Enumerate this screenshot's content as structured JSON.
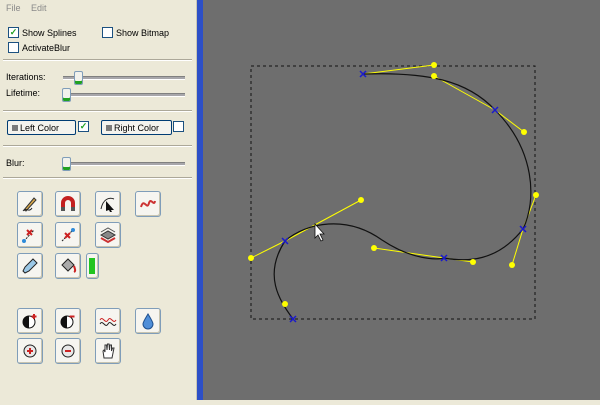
{
  "menu": {
    "file": "File",
    "edit": "Edit"
  },
  "options": {
    "show_splines": "Show Splines",
    "show_bitmap": "Show Bitmap",
    "activate_blur": "ActivateBlur",
    "show_splines_checked": true,
    "show_bitmap_checked": false,
    "activate_blur_checked": false
  },
  "sliders": {
    "iterations_label": "Iterations:",
    "iterations_value": 0.09,
    "lifetime_label": "Lifetime:",
    "lifetime_value": 0.02,
    "blur_label": "Blur:",
    "blur_value": 0.02
  },
  "colors": {
    "left_label": "Left Color",
    "right_label": "Right Color",
    "left_checked": true,
    "right_checked": false,
    "accent": "#21a121",
    "canvas_bg": "#6e6e6e",
    "curve": "#000000",
    "handle": "#ffff00",
    "knot": "#1a1acc"
  },
  "tools": [
    "pencil-icon",
    "magnet-icon",
    "pointer-curve-icon",
    "squiggle-icon",
    "node-left-icon",
    "node-right-icon",
    "layers-icon",
    "eyedropper-icon",
    "paint-bucket-icon",
    "color-bar-icon",
    "contrast-plus-icon",
    "contrast-minus-icon",
    "wave-icon",
    "drop-icon",
    "zoom-in-icon",
    "zoom-out-icon",
    "hand-icon"
  ]
}
